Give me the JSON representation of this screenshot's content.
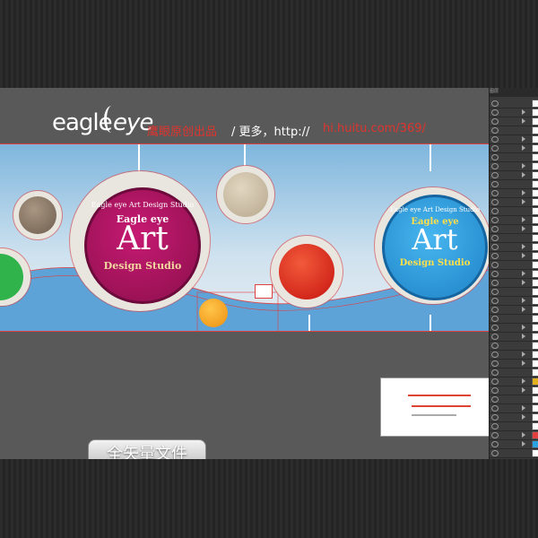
{
  "header": {
    "logo_eagle": "eagle",
    "logo_eye": "eye",
    "brand_cn": "鹰眼原创出品",
    "slash_text": "/ 更多，http://",
    "url": "hi.huitu.com/369/"
  },
  "badges": {
    "left": {
      "top": "Eagle eye  Art  Design Studio",
      "eagle": "Eagle eye",
      "art": "Art",
      "studio": "Design Studio"
    },
    "right": {
      "top": "Eagle eye  Art  Design Studio",
      "eagle": "Eagle eye",
      "art": "Art",
      "studio": "Design Studio"
    }
  },
  "footer_label": "全矢量文件",
  "colors": {
    "accent_red": "#e0342e",
    "magenta": "#b0125e",
    "blue": "#2aa3e0",
    "red_bubble": "#e4231f",
    "tan_bubble": "#cdbfa6",
    "brown_bubble": "#8c7a66",
    "green_bubble": "#2fb34a",
    "orange_bubble": "#f5a11d"
  },
  "layers_panel": {
    "tabs": "图层"
  }
}
